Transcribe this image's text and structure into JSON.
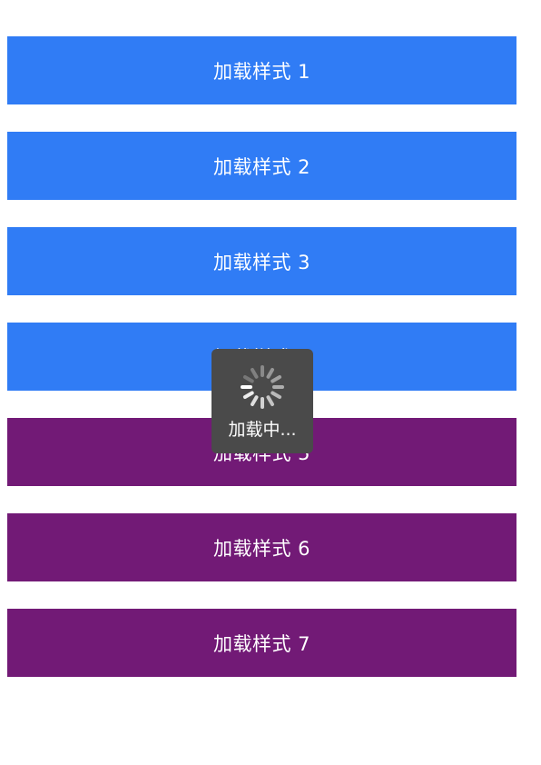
{
  "buttons": [
    {
      "label": "加载样式 1",
      "color": "#307CF5"
    },
    {
      "label": "加载样式 2",
      "color": "#307CF5"
    },
    {
      "label": "加载样式 3",
      "color": "#307CF5"
    },
    {
      "label": "加载样式 4",
      "color": "#307CF5"
    },
    {
      "label": "加载样式 5",
      "color": "#721A76"
    },
    {
      "label": "加载样式 6",
      "color": "#721A76"
    },
    {
      "label": "加载样式 7",
      "color": "#721A76"
    }
  ],
  "loading_toast": {
    "text": "加载中...",
    "icon": "spinner-icon"
  }
}
